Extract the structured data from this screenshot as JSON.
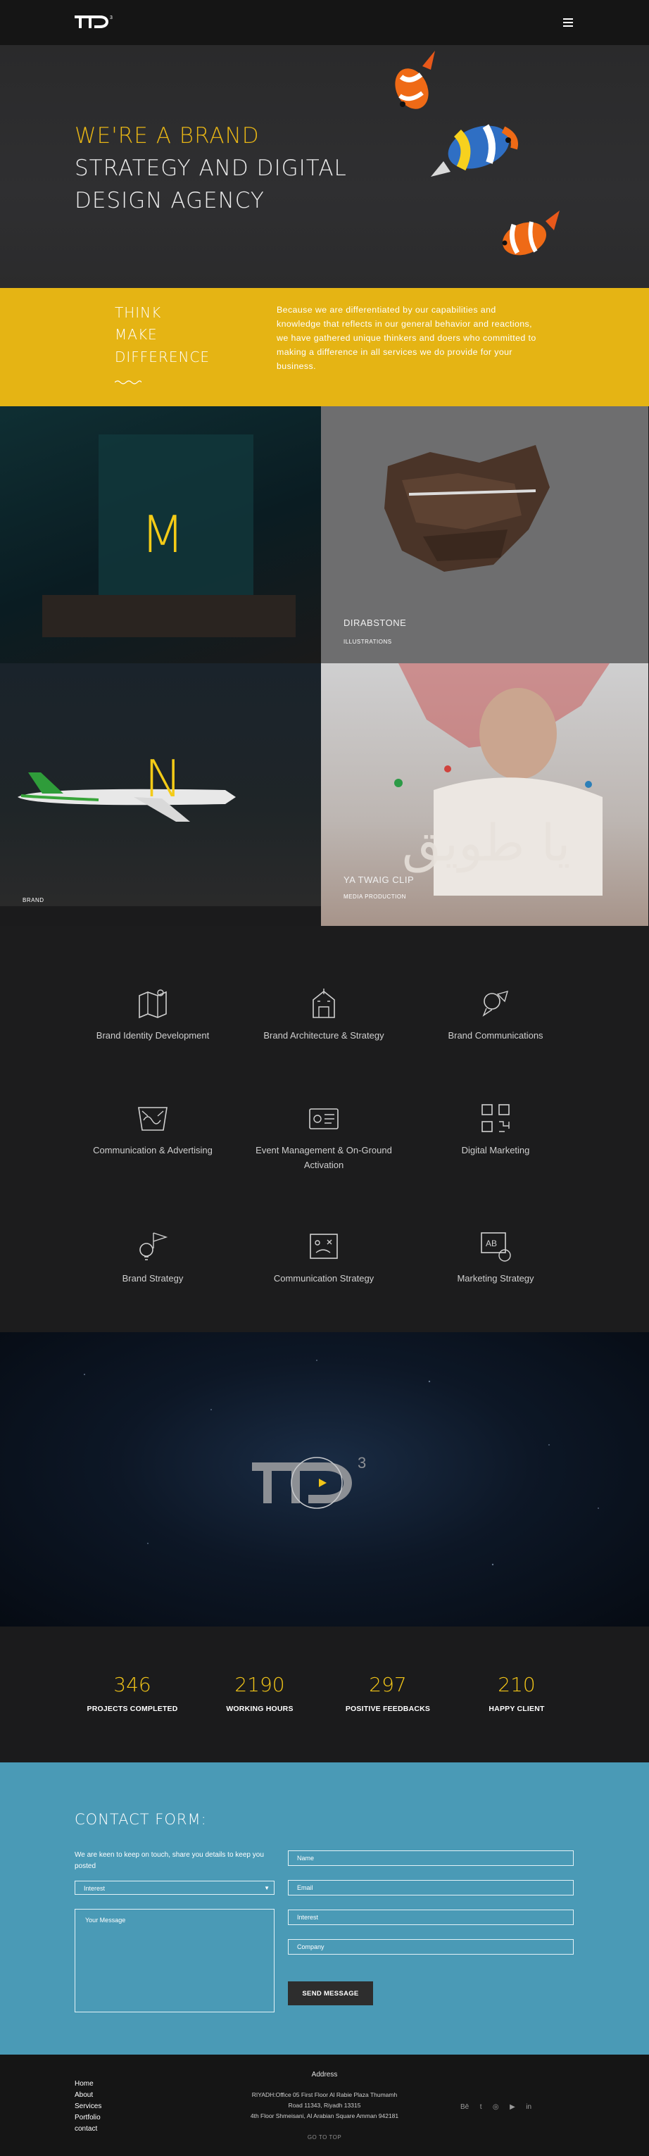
{
  "header": {
    "logo_text": "TTD",
    "logo_sup": "3",
    "menu_icon": "hamburger-icon"
  },
  "hero": {
    "line1": "WE'RE A BRAND",
    "line2": "STRATEGY AND DIGITAL",
    "line3": "DESIGN AGENCY"
  },
  "think": {
    "line1": "THINK",
    "line2": "MAKE",
    "line3": "DIFFERENCE",
    "paragraph": "Because we are differentiated by our capabilities and knowledge that reflects in our general behavior and reactions, we have gathered unique thinkers and doers who committed to making a difference in all services we do provide for your business."
  },
  "portfolio": {
    "items": [
      {
        "letter": "M",
        "title": "",
        "category": ""
      },
      {
        "letter": "",
        "title": "DIRABSTONE",
        "category": "ILLUSTRATIONS"
      },
      {
        "letter": "N",
        "title": "",
        "category": "BRAND"
      },
      {
        "letter": "",
        "title": "YA TWAIG CLIP",
        "category": "MEDIA PRODUCTION"
      }
    ]
  },
  "services": {
    "items": [
      {
        "label": "Brand Identity Development",
        "icon": "map-icon"
      },
      {
        "label": "Brand Architecture & Strategy",
        "icon": "building-icon"
      },
      {
        "label": "Brand Communications",
        "icon": "speech-bubbles-icon"
      },
      {
        "label": "Communication & Advertising",
        "icon": "megaphone-icon"
      },
      {
        "label": "Event Management & On-Ground Activation",
        "icon": "ticket-icon"
      },
      {
        "label": "Digital Marketing",
        "icon": "qr-code-icon"
      },
      {
        "label": "Brand Strategy",
        "icon": "lightbulb-flag-icon"
      },
      {
        "label": "Communication Strategy",
        "icon": "strategy-board-icon"
      },
      {
        "label": "Marketing Strategy",
        "icon": "ab-testing-icon"
      }
    ]
  },
  "video": {
    "logo_text": "TTD",
    "logo_sup": "3",
    "play_icon": "play-icon"
  },
  "stats": {
    "items": [
      {
        "value": "346",
        "label": "PROJECTS COMPLETED"
      },
      {
        "value": "2190",
        "label": "WORKING HOURS"
      },
      {
        "value": "297",
        "label": "POSITIVE FEEDBACKS"
      },
      {
        "value": "210",
        "label": "HAPPY CLIENT"
      }
    ]
  },
  "contact": {
    "title": "CONTACT FORM:",
    "description": "We are keen to keep on touch, share you details to keep you posted",
    "interest_select": "Interest",
    "message_placeholder": "Your Message",
    "name_placeholder": "Name",
    "email_placeholder": "Email",
    "interest_placeholder": "Interest",
    "company_placeholder": "Company",
    "send_label": "SEND MESSAGE"
  },
  "footer": {
    "links": [
      "Home",
      "About",
      "Services",
      "Portfolio",
      "contact"
    ],
    "address_title": "Address",
    "address_lines": [
      "RIYADH:Office 05 First Floor Al Rabie Plaza Thumamh",
      "Road 11343, Riyadh 13315",
      "4th Floor Shmeisani, Al Arabian Square Amman 942181"
    ],
    "social_icons": [
      "behance-icon",
      "twitter-icon",
      "instagram-icon",
      "youtube-icon",
      "linkedin-icon"
    ],
    "social_glyphs": [
      "Bē",
      "t",
      "◎",
      "▶",
      "in"
    ],
    "go_to_top": "GO TO TOP"
  }
}
